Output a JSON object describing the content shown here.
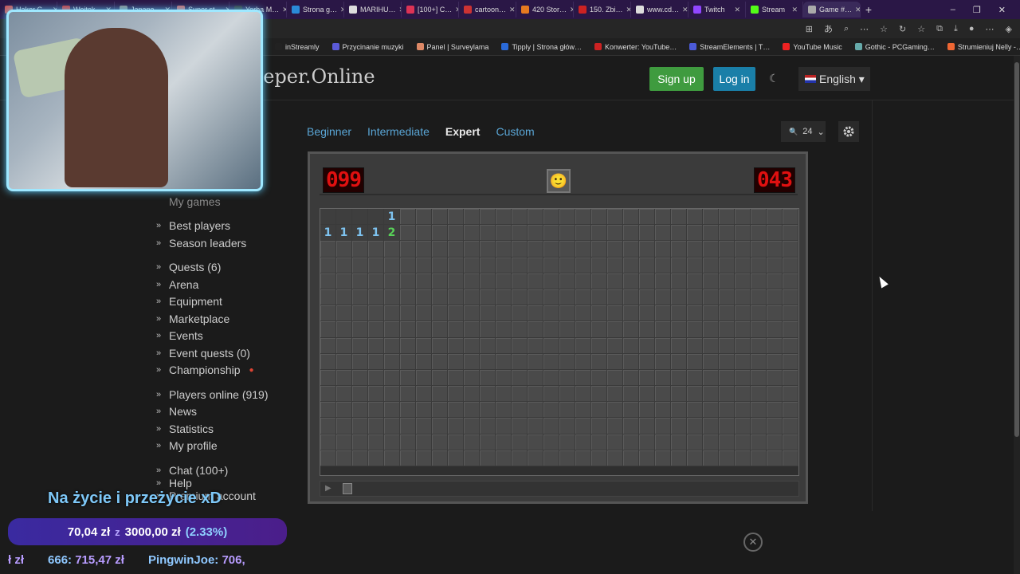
{
  "browser": {
    "tabs": [
      {
        "label": "Haker C…",
        "color": "#c55"
      },
      {
        "label": "Wojtek…",
        "color": "#c33"
      },
      {
        "label": "Japane…",
        "color": "#888"
      },
      {
        "label": "Super st…",
        "color": "#c66"
      },
      {
        "label": "Yerba M…",
        "color": "#333"
      },
      {
        "label": "Strona g…",
        "color": "#2a8ad8"
      },
      {
        "label": "MARIHU…",
        "color": "#ddd"
      },
      {
        "label": "[100+] C…",
        "color": "#d35"
      },
      {
        "label": "cartoon…",
        "color": "#c33"
      },
      {
        "label": "420 Stor…",
        "color": "#e67a20"
      },
      {
        "label": "150. Zbi…",
        "color": "#c22"
      },
      {
        "label": "www.cd…",
        "color": "#ddd"
      },
      {
        "label": "Twitch",
        "color": "#9146ff"
      },
      {
        "label": "Stream",
        "color": "#53fc18"
      },
      {
        "label": "Game #…",
        "color": "#aaa",
        "active": true
      }
    ],
    "new_tab": "+",
    "window_controls": {
      "minimize": "–",
      "restore": "❐",
      "close": "✕"
    },
    "bookmarks": [
      {
        "label": "inStreamly",
        "color": "#222"
      },
      {
        "label": "Przycinanie muzyki",
        "color": "#5b5ad8"
      },
      {
        "label": "Panel | Surveylama",
        "color": "#d86"
      },
      {
        "label": "Tipply | Strona głów…",
        "color": "#2a6ad8"
      },
      {
        "label": "Konwerter: YouTube…",
        "color": "#c22"
      },
      {
        "label": "StreamElements | T…",
        "color": "#4b5ad8"
      },
      {
        "label": "YouTube Music",
        "color": "#e22"
      },
      {
        "label": "Gothic - PCGaming…",
        "color": "#6aa"
      },
      {
        "label": "Strumieniuj Nelly -…",
        "color": "#e63"
      }
    ],
    "bookmarks_more": "›"
  },
  "header": {
    "logo": "eeper.Online",
    "signup": "Sign up",
    "login": "Log in",
    "theme_icon": "☾",
    "language": "English ▾"
  },
  "sidebar": {
    "groups": [
      [
        "My games"
      ],
      [
        "Best players",
        "Season leaders"
      ],
      [
        "Quests (6)",
        "Arena",
        "Equipment",
        "Marketplace",
        "Events",
        "Event quests (0)",
        "Championship"
      ],
      [
        "Players online (919)",
        "News",
        "Statistics",
        "My profile"
      ],
      [
        "Chat (100+)",
        "Help",
        "Premium account"
      ]
    ]
  },
  "levels": {
    "beginner": "Beginner",
    "intermediate": "Intermediate",
    "expert": "Expert",
    "custom": "Custom"
  },
  "zoom": {
    "icon": "🔍",
    "value": "24"
  },
  "game": {
    "mines_counter": "099",
    "timer": "043",
    "face": "🙂",
    "cols": 30,
    "rows": 16,
    "revealed": [
      {
        "row": 0,
        "col": 0,
        "value": ""
      },
      {
        "row": 0,
        "col": 1,
        "value": ""
      },
      {
        "row": 0,
        "col": 2,
        "value": ""
      },
      {
        "row": 0,
        "col": 3,
        "value": ""
      },
      {
        "row": 0,
        "col": 4,
        "value": "1"
      },
      {
        "row": 1,
        "col": 0,
        "value": "1"
      },
      {
        "row": 1,
        "col": 1,
        "value": "1"
      },
      {
        "row": 1,
        "col": 2,
        "value": "1"
      },
      {
        "row": 1,
        "col": 3,
        "value": "1"
      },
      {
        "row": 1,
        "col": 4,
        "value": "2"
      }
    ]
  },
  "overlay": {
    "caption": "Na życie i przeżycie xD",
    "goal_current": "70,04 zł",
    "goal_of": "z",
    "goal_target": "3000,00 zł",
    "goal_pct": "(2.33%)",
    "ticker": [
      {
        "prefix": "",
        "amount": "ł zł"
      },
      {
        "prefix": "666:",
        "amount": "715,47 zł"
      },
      {
        "prefix": "PingwinJoe:",
        "amount": "706,"
      }
    ],
    "close_icon": "✕"
  }
}
